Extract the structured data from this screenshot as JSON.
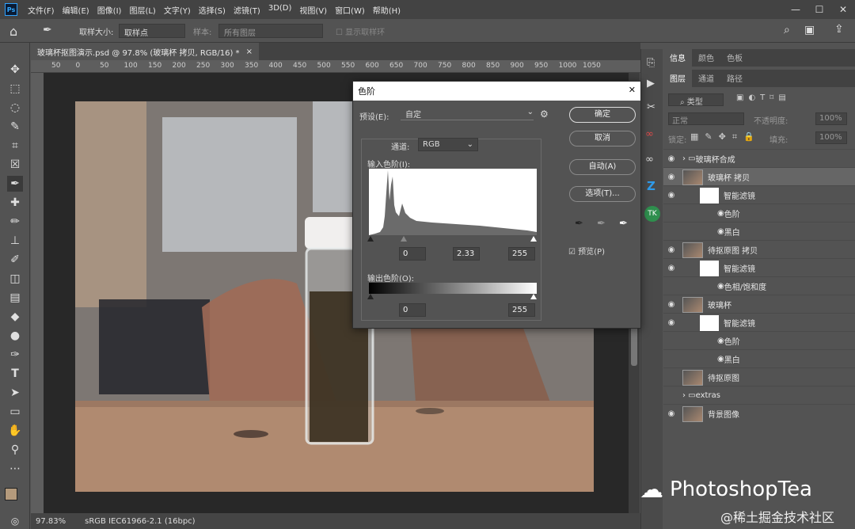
{
  "app": {
    "logo": "Ps"
  },
  "menu": [
    "文件(F)",
    "编辑(E)",
    "图像(I)",
    "图层(L)",
    "文字(Y)",
    "选择(S)",
    "滤镜(T)",
    "3D(D)",
    "视图(V)",
    "窗口(W)",
    "帮助(H)"
  ],
  "options": {
    "size_label": "取样大小:",
    "size_value": "取样点",
    "sample_label": "样本:",
    "sample_value": "所有图层",
    "show_ring": "显示取样环"
  },
  "doc_tab": {
    "title": "玻璃杯抠图演示.psd @ 97.8% (玻璃杯 拷贝, RGB/16) *",
    "close": "×"
  },
  "ruler_ticks": [
    "50",
    "0",
    "50",
    "100",
    "150",
    "200",
    "250",
    "300",
    "350",
    "400",
    "450",
    "500",
    "550",
    "600",
    "650",
    "700",
    "750",
    "800",
    "850",
    "900",
    "950",
    "1000",
    "1050"
  ],
  "status": {
    "zoom": "97.83%",
    "profile": "sRGB IEC61966-2.1 (16bpc)"
  },
  "panels": {
    "top_tabs": [
      "信息",
      "颜色",
      "色板"
    ],
    "layer_tabs": [
      "图层",
      "通道",
      "路径"
    ],
    "kind": "类型",
    "blend": "正常",
    "opacity_label": "不透明度:",
    "opacity": "100%",
    "lock_label": "锁定:",
    "fill_label": "填充:",
    "fill": "100%"
  },
  "layers": [
    {
      "name": "玻璃杯合成",
      "type": "group",
      "visible": true,
      "indent": 0
    },
    {
      "name": "玻璃杯 拷贝",
      "type": "smart",
      "visible": true,
      "indent": 0,
      "selected": true
    },
    {
      "name": "智能滤镜",
      "type": "filtermask",
      "visible": true,
      "indent": 1
    },
    {
      "name": "色阶",
      "type": "filter",
      "visible": true,
      "indent": 2
    },
    {
      "name": "黑白",
      "type": "filter",
      "visible": true,
      "indent": 2
    },
    {
      "name": "待抠原图 拷贝",
      "type": "smart",
      "visible": true,
      "indent": 0
    },
    {
      "name": "智能滤镜",
      "type": "filtermask",
      "visible": true,
      "indent": 1
    },
    {
      "name": "色相/饱和度",
      "type": "filter",
      "visible": true,
      "indent": 2
    },
    {
      "name": "玻璃杯",
      "type": "smart",
      "visible": true,
      "indent": 0
    },
    {
      "name": "智能滤镜",
      "type": "filtermask",
      "visible": true,
      "indent": 1
    },
    {
      "name": "色阶",
      "type": "filter",
      "visible": true,
      "indent": 2
    },
    {
      "name": "黑白",
      "type": "filter",
      "visible": true,
      "indent": 2
    },
    {
      "name": "待抠原图",
      "type": "image",
      "visible": false,
      "indent": 0
    },
    {
      "name": "extras",
      "type": "folder",
      "visible": false,
      "indent": 0
    },
    {
      "name": "背景图像",
      "type": "image",
      "visible": true,
      "indent": 0
    }
  ],
  "dialog": {
    "title": "色阶",
    "close": "✕",
    "preset_label": "预设(E):",
    "preset_value": "自定",
    "channel_label": "通道:",
    "channel_value": "RGB",
    "input_label": "输入色阶(I):",
    "output_label": "输出色阶(O):",
    "input_black": "0",
    "input_gamma": "2.33",
    "input_white": "255",
    "output_black": "0",
    "output_white": "255",
    "ok": "确定",
    "cancel": "取消",
    "auto": "自动(A)",
    "options": "选项(T)...",
    "preview": "预览(P)",
    "preview_checked": true
  },
  "watermark": {
    "brand": "PhotoshopTea",
    "site": "@稀土掘金技术社区"
  }
}
